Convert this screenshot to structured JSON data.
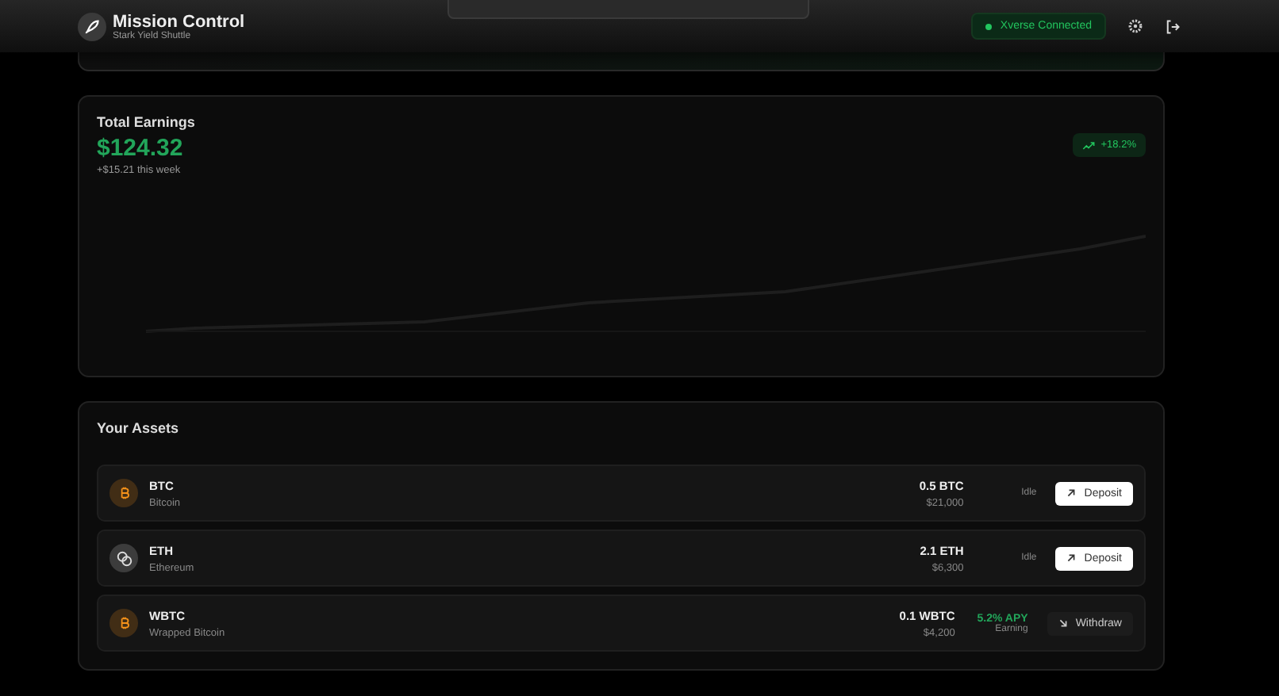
{
  "header": {
    "title": "Mission Control",
    "subtitle": "Stark Yield Shuttle",
    "wallet_status": "Xverse Connected"
  },
  "earnings": {
    "title": "Total Earnings",
    "amount": "$124.32",
    "weekly": "+$15.21 this week",
    "change": "+18.2%"
  },
  "assets": {
    "title": "Your Assets",
    "items": [
      {
        "kind": "bitcoin",
        "color": "#f7931a",
        "symbol": "BTC",
        "name": "Bitcoin",
        "amount": "0.5 BTC",
        "value": "$21,000",
        "earning": false,
        "status": "Idle",
        "action": "Deposit"
      },
      {
        "kind": "coins",
        "color": "#dddddd",
        "symbol": "ETH",
        "name": "Ethereum",
        "amount": "2.1 ETH",
        "value": "$6,300",
        "earning": false,
        "status": "Idle",
        "action": "Deposit"
      },
      {
        "kind": "bitcoin",
        "color": "#f7931a",
        "symbol": "WBTC",
        "name": "Wrapped Bitcoin",
        "amount": "0.1 WBTC",
        "value": "$4,200",
        "earning": true,
        "apy": "5.2% APY",
        "status": "Earning",
        "action": "Withdraw"
      }
    ]
  }
}
